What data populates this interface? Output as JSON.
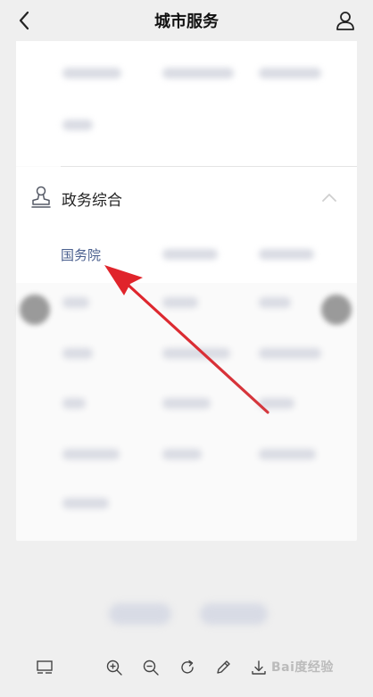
{
  "header": {
    "title": "城市服务"
  },
  "section": {
    "title": "政务综合",
    "first_item": "国务院"
  },
  "watermark": {
    "text": "Bai度经验"
  },
  "icons": {
    "back": "chevron-left-icon",
    "user": "user-icon",
    "stamp": "stamp-icon",
    "collapse": "chevron-up-icon",
    "layout": "layout-icon",
    "zoom_in": "zoom-in-icon",
    "zoom_out": "zoom-out-icon",
    "rotate": "rotate-icon",
    "edit": "pencil-icon",
    "download": "download-icon"
  },
  "colors": {
    "link": "#4a5f8e",
    "arrow": "#e0242b",
    "background": "#efefef"
  }
}
